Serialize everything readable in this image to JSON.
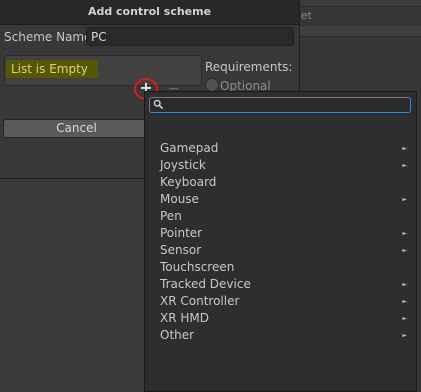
{
  "background": {
    "tab_label": "set"
  },
  "dialog": {
    "title": "Add control scheme",
    "scheme_name_label": "Scheme Name",
    "scheme_name_value": "PC",
    "list_empty_text": "List is Empty",
    "add_button_label": "+",
    "remove_button_label": "−",
    "requirements_label": "Requirements:",
    "optional_label": "Optional",
    "cancel_label": "Cancel"
  },
  "menu": {
    "search_value": "",
    "items": [
      {
        "label": "Gamepad",
        "submenu": true,
        "arrow": "►"
      },
      {
        "label": "Joystick",
        "submenu": true,
        "arrow": "►"
      },
      {
        "label": "Keyboard",
        "submenu": false,
        "arrow": ""
      },
      {
        "label": "Mouse",
        "submenu": true,
        "arrow": "►"
      },
      {
        "label": "Pen",
        "submenu": false,
        "arrow": ""
      },
      {
        "label": "Pointer",
        "submenu": true,
        "arrow": "►"
      },
      {
        "label": "Sensor",
        "submenu": true,
        "arrow": "►"
      },
      {
        "label": "Touchscreen",
        "submenu": false,
        "arrow": ""
      },
      {
        "label": "Tracked Device",
        "submenu": true,
        "arrow": "►"
      },
      {
        "label": "XR Controller",
        "submenu": true,
        "arrow": "►"
      },
      {
        "label": "XR HMD",
        "submenu": true,
        "arrow": "►"
      },
      {
        "label": "Other",
        "submenu": true,
        "arrow": "►"
      }
    ]
  },
  "colors": {
    "accent_focus": "#4a82c4",
    "highlight_bg": "#565607",
    "highlight_text": "#d9d960",
    "annotation_circle": "#e01818"
  }
}
